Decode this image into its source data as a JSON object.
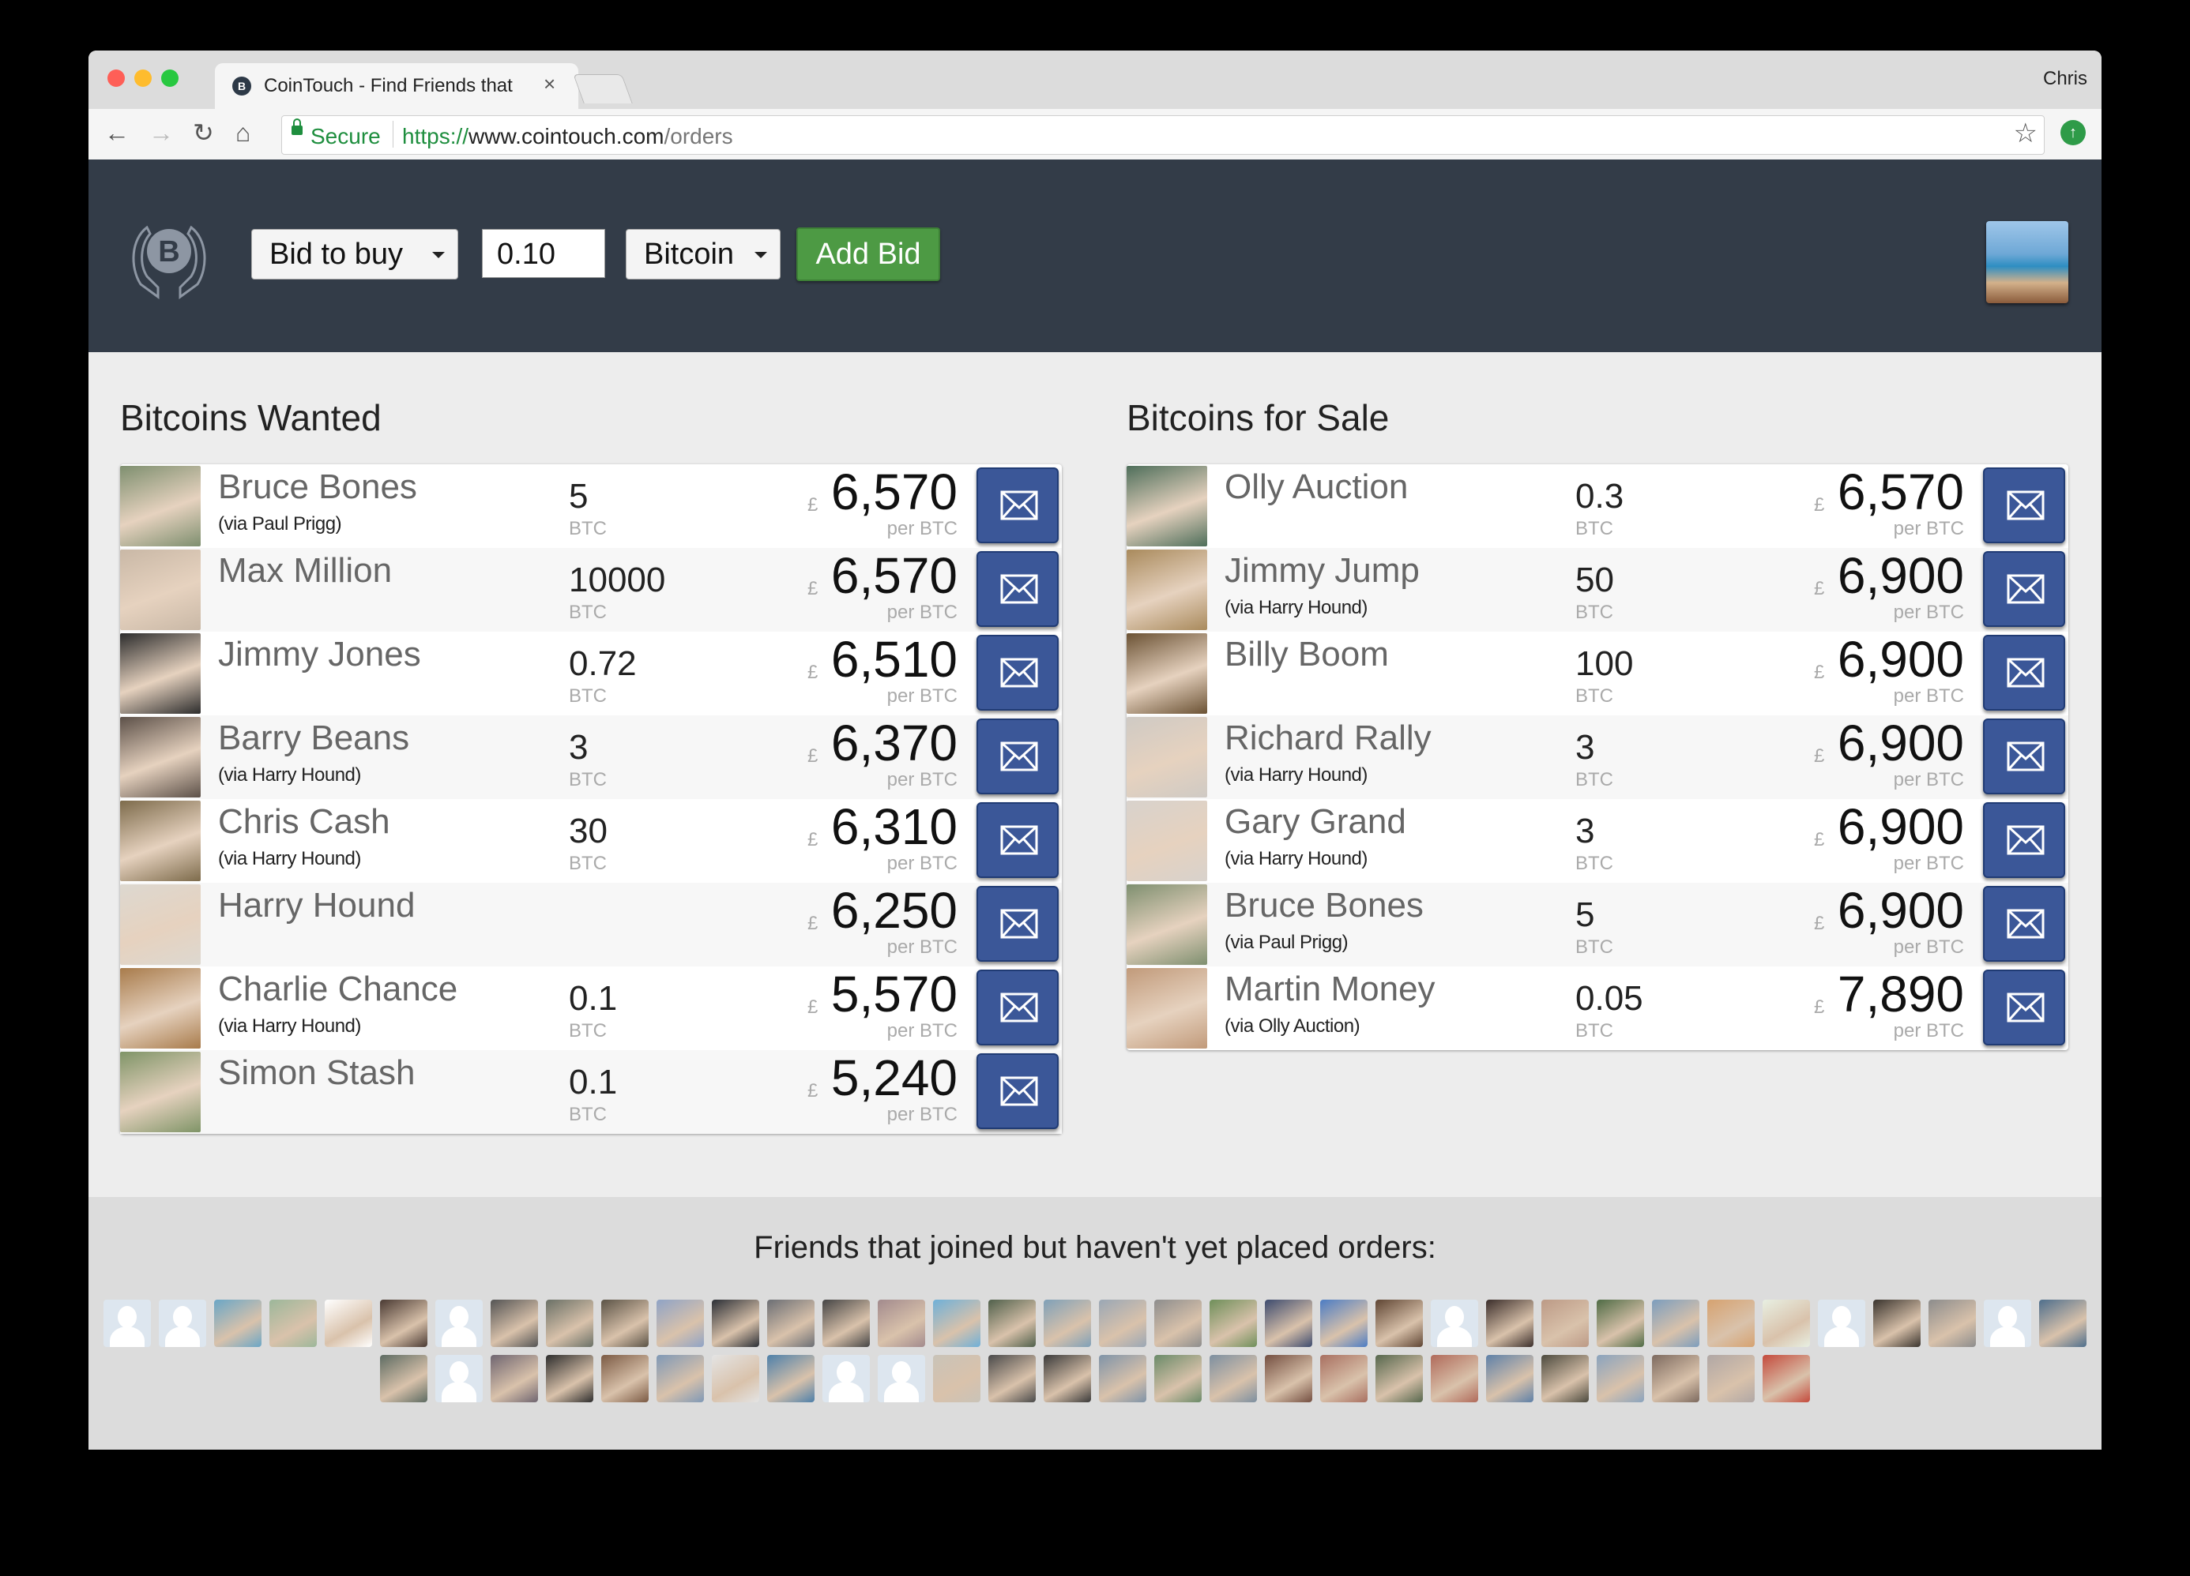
{
  "browser": {
    "tab_title": "CoinTouch - Find Friends that",
    "profile_name": "Chris",
    "secure_label": "Secure",
    "url_scheme": "https://",
    "url_host": "www.cointouch.com",
    "url_path": "/orders"
  },
  "header": {
    "bid_type": "Bid to buy",
    "amount": "0.10",
    "currency": "Bitcoin",
    "add_bid_label": "Add Bid"
  },
  "wanted": {
    "title": "Bitcoins Wanted",
    "rows": [
      {
        "name": "Bruce Bones",
        "via": "(via Paul Prigg)",
        "qty": "5",
        "unit": "BTC",
        "currency_symbol": "£",
        "price": "6,570",
        "per": "per BTC"
      },
      {
        "name": "Max Million",
        "via": "",
        "qty": "10000",
        "unit": "BTC",
        "currency_symbol": "£",
        "price": "6,570",
        "per": "per BTC"
      },
      {
        "name": "Jimmy Jones",
        "via": "",
        "qty": "0.72",
        "unit": "BTC",
        "currency_symbol": "£",
        "price": "6,510",
        "per": "per BTC"
      },
      {
        "name": "Barry Beans",
        "via": "(via Harry Hound)",
        "qty": "3",
        "unit": "BTC",
        "currency_symbol": "£",
        "price": "6,370",
        "per": "per BTC"
      },
      {
        "name": "Chris Cash",
        "via": "(via Harry Hound)",
        "qty": "30",
        "unit": "BTC",
        "currency_symbol": "£",
        "price": "6,310",
        "per": "per BTC"
      },
      {
        "name": "Harry Hound",
        "via": "",
        "qty": "",
        "unit": "",
        "currency_symbol": "£",
        "price": "6,250",
        "per": "per BTC"
      },
      {
        "name": "Charlie Chance",
        "via": "(via Harry Hound)",
        "qty": "0.1",
        "unit": "BTC",
        "currency_symbol": "£",
        "price": "5,570",
        "per": "per BTC"
      },
      {
        "name": "Simon Stash",
        "via": "",
        "qty": "0.1",
        "unit": "BTC",
        "currency_symbol": "£",
        "price": "5,240",
        "per": "per BTC"
      }
    ]
  },
  "sale": {
    "title": "Bitcoins for Sale",
    "rows": [
      {
        "name": "Olly Auction",
        "via": "",
        "qty": "0.3",
        "unit": "BTC",
        "currency_symbol": "£",
        "price": "6,570",
        "per": "per BTC"
      },
      {
        "name": "Jimmy Jump",
        "via": "(via Harry Hound)",
        "qty": "50",
        "unit": "BTC",
        "currency_symbol": "£",
        "price": "6,900",
        "per": "per BTC"
      },
      {
        "name": "Billy Boom",
        "via": "",
        "qty": "100",
        "unit": "BTC",
        "currency_symbol": "£",
        "price": "6,900",
        "per": "per BTC"
      },
      {
        "name": "Richard Rally",
        "via": "(via Harry Hound)",
        "qty": "3",
        "unit": "BTC",
        "currency_symbol": "£",
        "price": "6,900",
        "per": "per BTC"
      },
      {
        "name": "Gary Grand",
        "via": "(via Harry Hound)",
        "qty": "3",
        "unit": "BTC",
        "currency_symbol": "£",
        "price": "6,900",
        "per": "per BTC"
      },
      {
        "name": "Bruce Bones",
        "via": "(via Paul Prigg)",
        "qty": "5",
        "unit": "BTC",
        "currency_symbol": "£",
        "price": "6,900",
        "per": "per BTC"
      },
      {
        "name": "Martin Money",
        "via": "(via Olly Auction)",
        "qty": "0.05",
        "unit": "BTC",
        "currency_symbol": "£",
        "price": "7,890",
        "per": "per BTC"
      }
    ]
  },
  "friends": {
    "title": "Friends that joined but haven't yet placed orders:",
    "row1": [
      "placeholder",
      "placeholder",
      "#6aa6c6",
      "#9cb79a",
      "#ffffff",
      "#4a3a33",
      "placeholder",
      "#545454",
      "#6a7066",
      "#5b5346",
      "#8fa3c6",
      "#2b2f36",
      "#6b6e74",
      "#454545",
      "#a28a8d",
      "#6fb0d8",
      "#50604b",
      "#7fa0b8",
      "#9aa7b5",
      "#8d8d8d",
      "#6f8f5a",
      "#3d4b6e",
      "#4c7cc4",
      "#5f4533",
      "placeholder",
      "#3b2e2b",
      "#bc9a86",
      "#4f6b45",
      "#7c9dbd",
      "#d6a270",
      "#e8efe2",
      "placeholder",
      "#3a342e",
      "#8c8c8c",
      "placeholder",
      "#4e6e8c"
    ],
    "row2": [
      "#5d6b62",
      "placeholder",
      "#6f6570",
      "#2d2d2d",
      "#7b5a44",
      "#7f98b6",
      "#e4e4e4",
      "#4d7fa9",
      "placeholder",
      "placeholder",
      "#c9c3b8",
      "#4a4a4a",
      "#3a3a3a",
      "#7f93a8",
      "#6a8a68",
      "#7d8fa0",
      "#744f41",
      "#a86f60",
      "#56674d",
      "#b06a5a",
      "#5e80a8",
      "#4c4a3e",
      "#8aa3be",
      "#7d6a5f",
      "#b0a7a5",
      "#c44a3c"
    ]
  },
  "icons": {
    "logo": "bitcoin-hands-logo-icon",
    "mail": "envelope-icon",
    "accent_green": "#4d9a44",
    "header_bg": "#333c48",
    "mail_blue": "#3b5798"
  }
}
